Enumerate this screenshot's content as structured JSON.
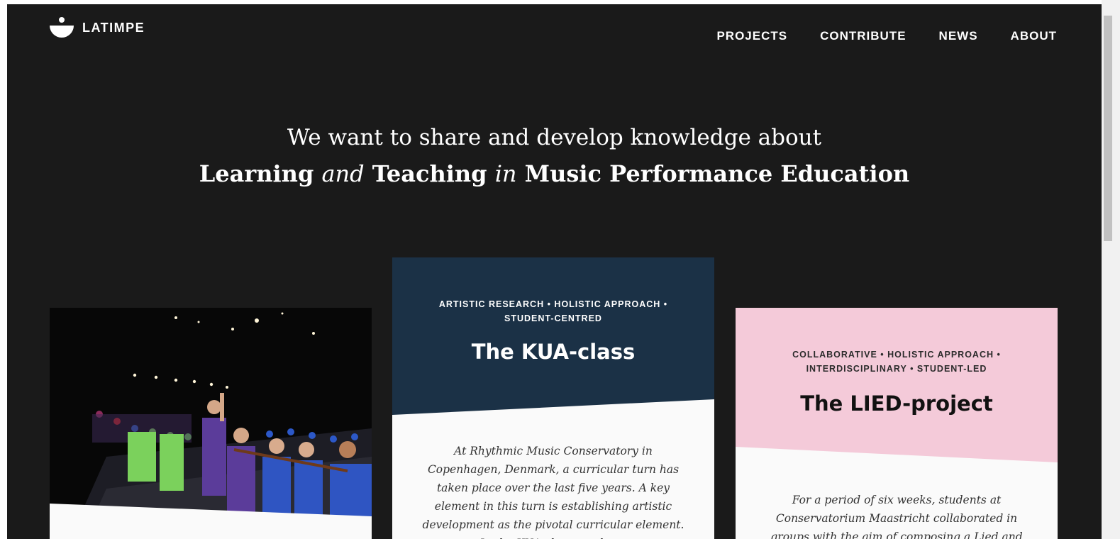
{
  "header": {
    "logo_text": "LATIMPE",
    "nav": [
      {
        "label": "PROJECTS"
      },
      {
        "label": "CONTRIBUTE"
      },
      {
        "label": "NEWS"
      },
      {
        "label": "ABOUT"
      }
    ]
  },
  "hero": {
    "line1": "We want to share and develop knowledge about",
    "line2": {
      "part1": "Learning",
      "part2": "and",
      "part3": "Teaching",
      "part4": "in",
      "part5": "Music Performance Education"
    }
  },
  "cards": {
    "kua": {
      "tags": "ARTISTIC RESEARCH • HOLISTIC APPROACH • STUDENT-CENTRED",
      "title": "The KUA-class",
      "excerpt": "At Rhythmic Music Conservatory in Copenhagen, Denmark, a curricular turn has taken place over the last five years. A key element in this turn is establishing artistic development as the pivotal curricular element. In the KUA-class, students"
    },
    "lied": {
      "tags": "COLLABORATIVE • HOLISTIC APPROACH • INTERDISCIPLINARY • STUDENT-LED",
      "title": "The LIED-project",
      "excerpt": "For a period of six weeks, students at Conservatorium Maastricht collaborated in groups with the aim of composing a Lied and"
    }
  },
  "colors": {
    "background": "#1a1a1a",
    "kua_card": "#1b3146",
    "lied_card": "#f4cad9",
    "card_body": "#fafafa"
  }
}
